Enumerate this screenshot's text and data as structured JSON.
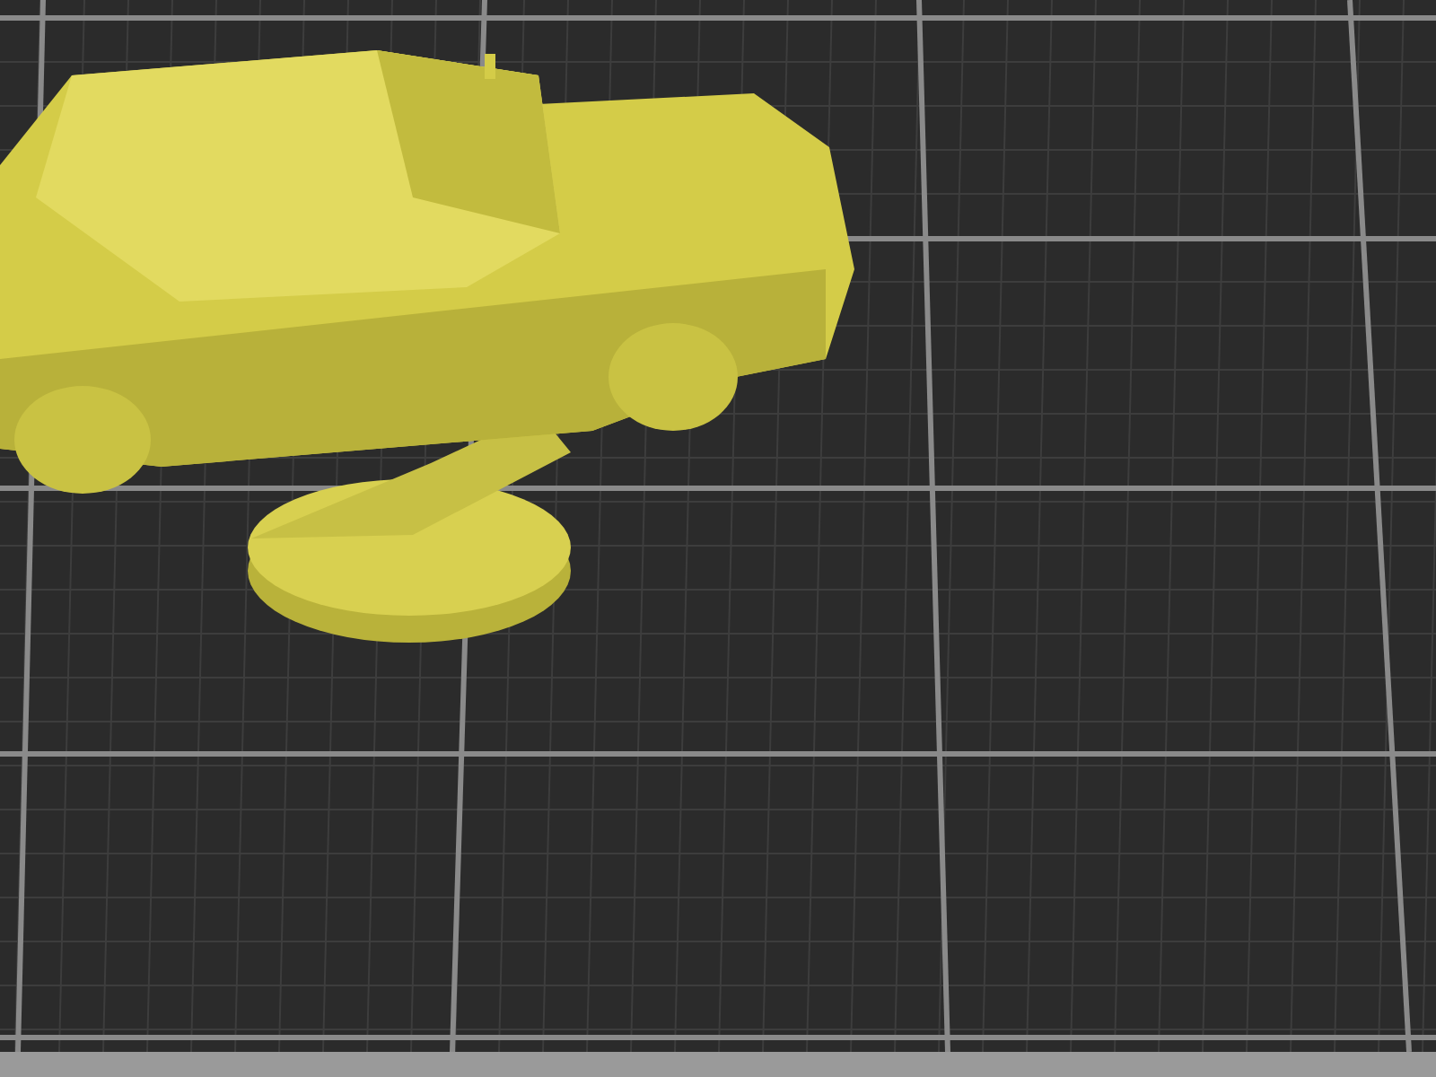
{
  "viewport": {
    "kind": "print-bed",
    "model": {
      "kind": "car-on-stand"
    }
  }
}
